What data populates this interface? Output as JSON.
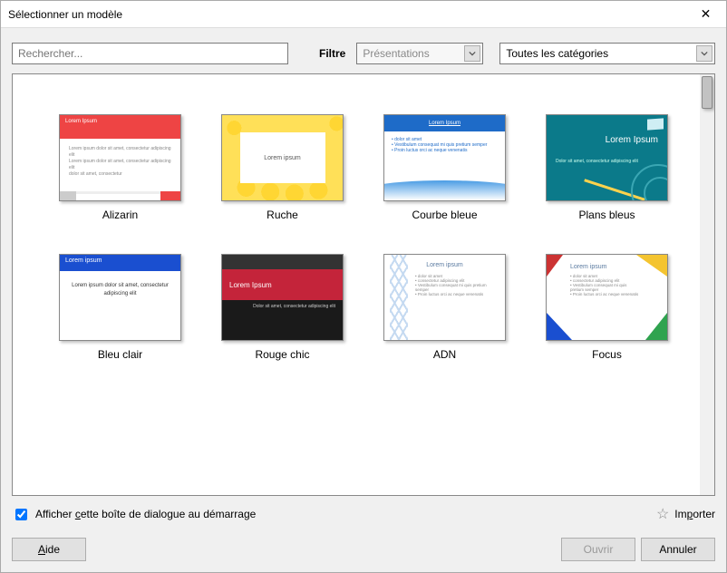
{
  "window": {
    "title": "Sélectionner un modèle"
  },
  "search": {
    "placeholder": "Rechercher..."
  },
  "filter": {
    "label": "Filtre",
    "application": "Présentations",
    "category": "Toutes les catégories"
  },
  "templates": [
    {
      "name": "Alizarin"
    },
    {
      "name": "Ruche"
    },
    {
      "name": "Courbe bleue"
    },
    {
      "name": "Plans bleus"
    },
    {
      "name": "Bleu clair"
    },
    {
      "name": "Rouge chic"
    },
    {
      "name": "ADN"
    },
    {
      "name": "Focus"
    }
  ],
  "thumb_text": {
    "lorem": "Lorem Ipsum",
    "lorem_lc": "Lorem ipsum",
    "sub_long": "Lorem ipsum dolor sit amet, consectetur adipiscing elit",
    "sub_short": "dolor sit amet, consectetur",
    "bullets": [
      "dolor sit amet",
      "consectetur adipiscing elit",
      "Vestibulum consequat mi quis pretium semper",
      "Proin luctus orci ac neque venenatis"
    ],
    "dolor": "Dolor sit amet, consectetur adipiscing elit"
  },
  "footer": {
    "show_on_startup": "Afficher cette boîte de dialogue au démarrage",
    "import": "Importer"
  },
  "buttons": {
    "help": "Aide",
    "open": "Ouvrir",
    "cancel": "Annuler"
  }
}
